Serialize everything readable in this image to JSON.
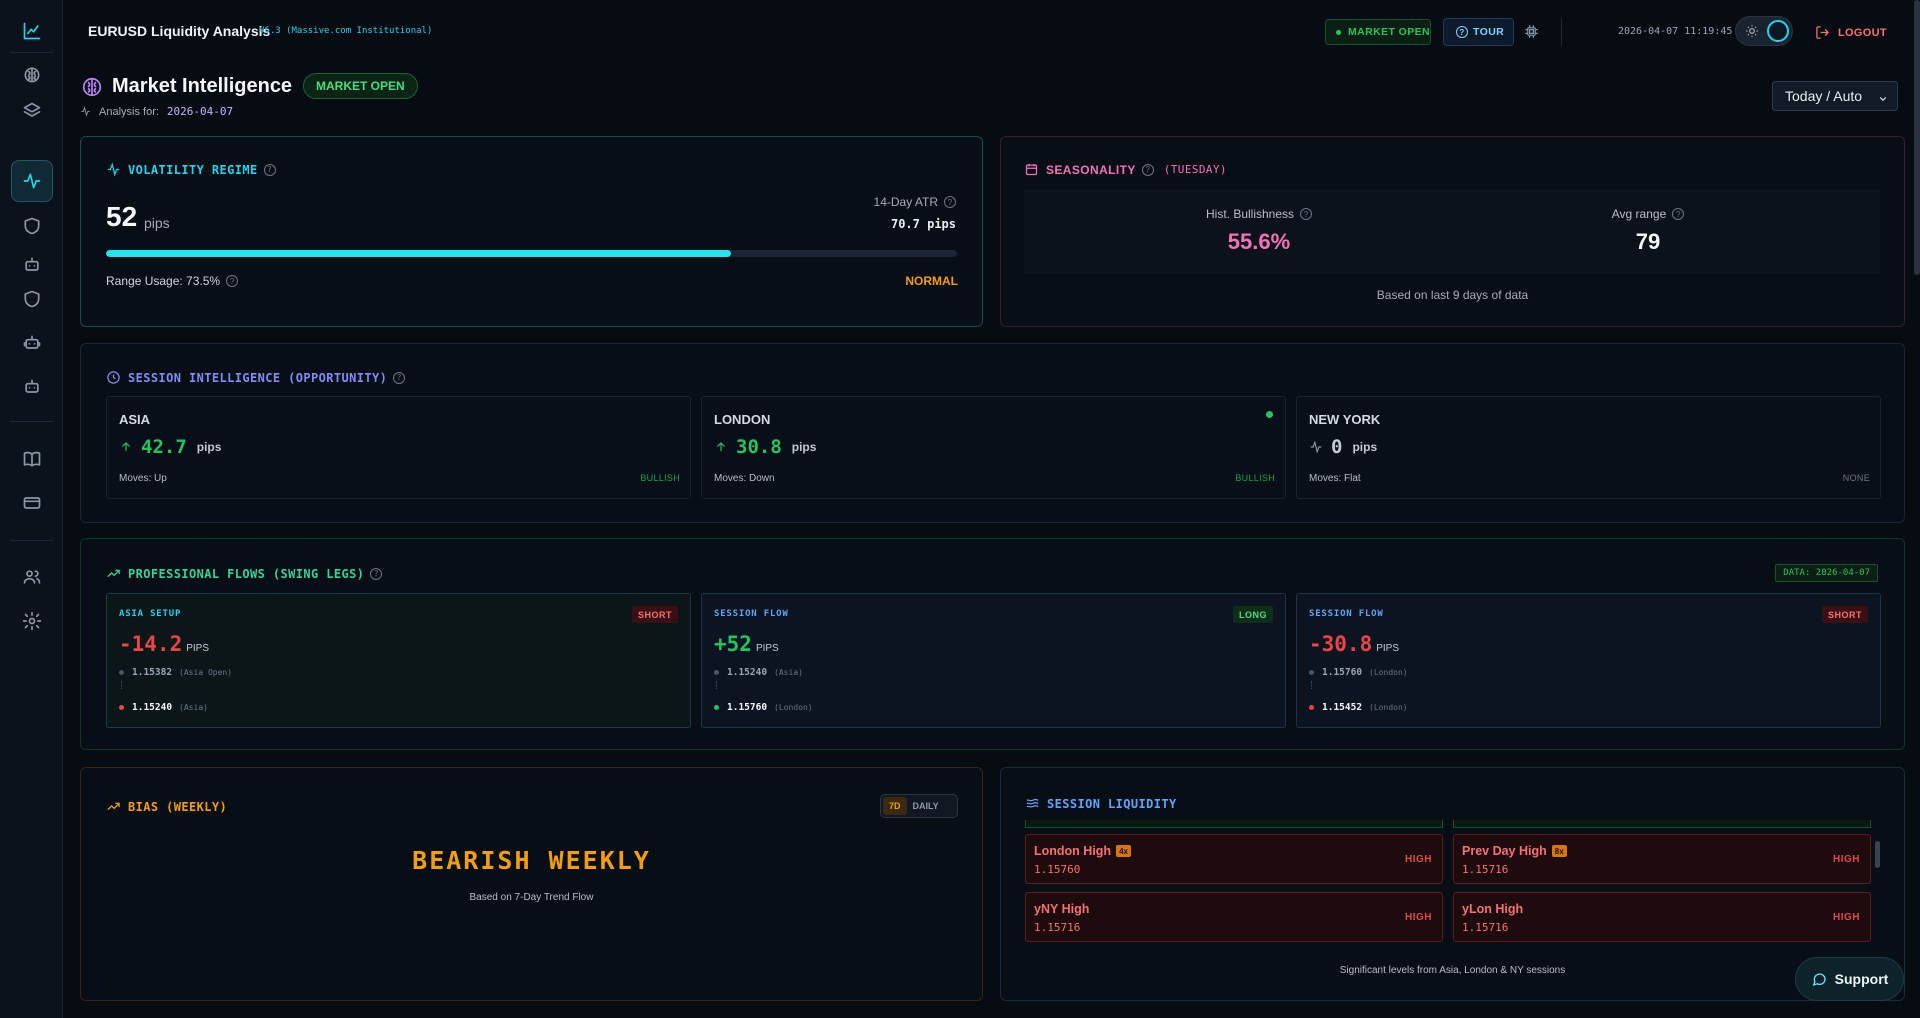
{
  "header": {
    "app_title": "EURUSD Liquidity Analysis",
    "version": "V6.3 (Massive.com Institutional)",
    "market_status": "MARKET OPEN",
    "tour_label": "TOUR",
    "clock": "2026-04-07 11:19:45",
    "logout_label": "LOGOUT"
  },
  "page": {
    "title": "Market Intelligence",
    "badge": "MARKET OPEN",
    "analysis_label": "Analysis for:",
    "analysis_date": "2026-04-07",
    "range_select": "Today / Auto"
  },
  "volatility": {
    "title": "VOLATILITY REGIME",
    "value": "52",
    "unit": "pips",
    "atr_label": "14-Day ATR",
    "atr_value": "70.7 pips",
    "usage_label": "Range Usage: 73.5%",
    "usage_fraction": 0.735,
    "regime": "NORMAL",
    "color": "#22e3f0"
  },
  "seasonality": {
    "title": "SEASONALITY",
    "day": "(TUESDAY)",
    "bull_label": "Hist. Bullishness",
    "bull_value": "55.6%",
    "range_label": "Avg range",
    "range_value": "79",
    "footer": "Based on last 9 days of data",
    "bull_color": "#f472b6"
  },
  "sessions": {
    "title": "SESSION INTELLIGENCE (OPPORTUNITY)",
    "items": [
      {
        "name": "ASIA",
        "value": "42.7",
        "unit": "pips",
        "moves": "Moves: Up",
        "tag": "BULLISH",
        "icon": "arrow-up-icon"
      },
      {
        "name": "LONDON",
        "value": "30.8",
        "unit": "pips",
        "moves": "Moves: Down",
        "tag": "BULLISH",
        "icon": "arrow-up-icon"
      },
      {
        "name": "NEW YORK",
        "value": "0",
        "unit": "pips",
        "moves": "Moves: Flat",
        "tag": "NONE",
        "icon": "pulse-icon"
      }
    ]
  },
  "flows": {
    "title": "PROFESSIONAL FLOWS (SWING LEGS)",
    "data_tag": "DATA: 2026-04-07",
    "items": [
      {
        "kind": "ASIA SETUP",
        "dir": "SHORT",
        "value": "-14.2",
        "unit": "PIPS",
        "from_px": "1.15382",
        "from_tag": "(Asia Open)",
        "to_px": "1.15240",
        "to_tag": "(Asia)"
      },
      {
        "kind": "SESSION FLOW",
        "dir": "LONG",
        "value": "+52",
        "unit": "PIPS",
        "from_px": "1.15240",
        "from_tag": "(Asia)",
        "to_px": "1.15760",
        "to_tag": "(London)"
      },
      {
        "kind": "SESSION FLOW",
        "dir": "SHORT",
        "value": "-30.8",
        "unit": "PIPS",
        "from_px": "1.15760",
        "from_tag": "(London)",
        "to_px": "1.15452",
        "to_tag": "(London)"
      }
    ]
  },
  "bias": {
    "title": "BIAS (WEEKLY)",
    "opt_7d": "7D",
    "opt_daily": "DAILY",
    "value": "BEARISH WEEKLY",
    "sub": "Based on 7-Day Trend Flow"
  },
  "liquidity": {
    "title": "SESSION LIQUIDITY",
    "items": [
      {
        "name": "London High",
        "count": "4x",
        "price": "1.15760",
        "importance": "HIGH"
      },
      {
        "name": "Prev Day High",
        "count": "8x",
        "price": "1.15716",
        "importance": "HIGH"
      },
      {
        "name": "yNY High",
        "count": "",
        "price": "1.15716",
        "importance": "HIGH"
      },
      {
        "name": "yLon High",
        "count": "",
        "price": "1.15716",
        "importance": "HIGH"
      }
    ],
    "footer": "Significant levels from Asia, London & NY sessions"
  },
  "support_label": "Support"
}
